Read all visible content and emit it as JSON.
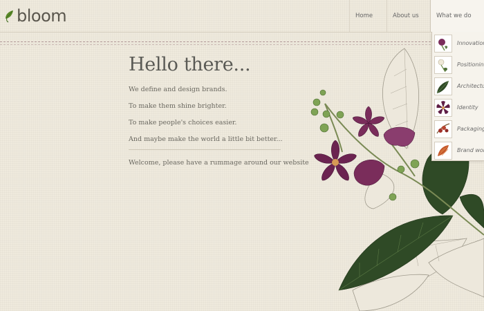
{
  "brand": {
    "name": "bloom",
    "logo_icon": "leaf-icon"
  },
  "nav": {
    "items": [
      {
        "label": "Home"
      },
      {
        "label": "About us"
      },
      {
        "label": "What we do"
      }
    ]
  },
  "submenu": {
    "items": [
      {
        "label": "Innovation",
        "icon": "purple-flower-thumb"
      },
      {
        "label": "Positioning",
        "icon": "white-flower-thumb"
      },
      {
        "label": "Architecture",
        "icon": "green-leaf-thumb"
      },
      {
        "label": "Identity",
        "icon": "purple-star-flower-thumb"
      },
      {
        "label": "Packaging",
        "icon": "red-berry-thumb"
      },
      {
        "label": "Brand wor",
        "icon": "orange-flower-thumb"
      }
    ]
  },
  "main": {
    "heading": "Hello there...",
    "lines": [
      "We define and design brands.",
      "To make them shine brighter.",
      "To make people's choices easier.",
      "And maybe make the world a little bit better..."
    ],
    "welcome": "Welcome, please have a rummage around our website"
  },
  "colors": {
    "background": "#efeadd",
    "leaf_green": "#2f4a26",
    "flower_purple": "#6b2350",
    "text": "#6a6860"
  }
}
